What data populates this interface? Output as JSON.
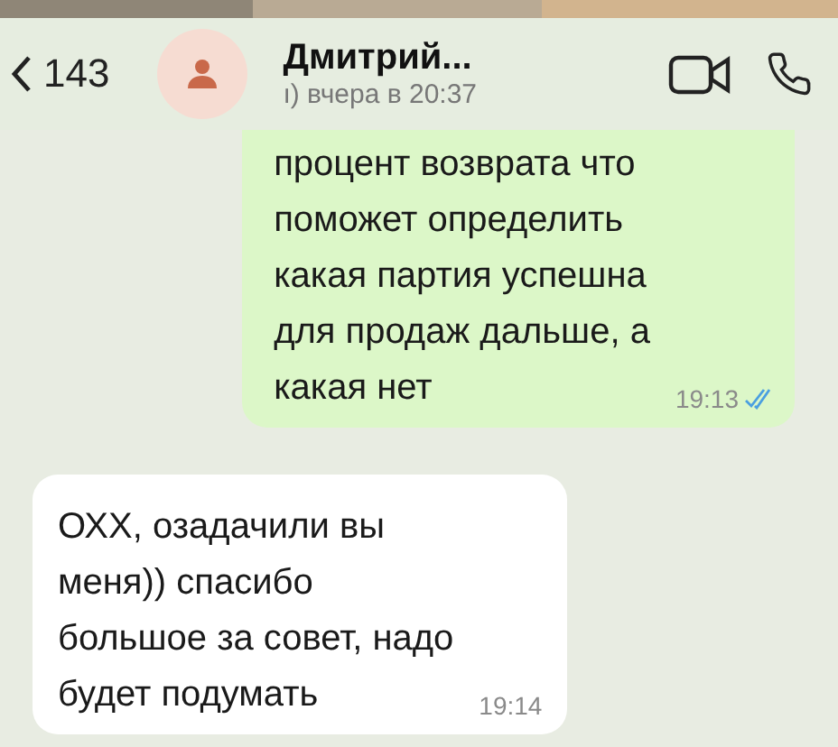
{
  "header": {
    "back_count": "143",
    "contact_name": "Дмитрий...",
    "status": "ı) вчера в 20:37"
  },
  "messages": [
    {
      "kind": "outgoing",
      "text": "процент возврата что\nпоможет определить\nкакая партия успешна\nдля продаж дальше, а\nкакая нет",
      "time": "19:13",
      "read": true
    },
    {
      "kind": "incoming",
      "text": "ОХХ, озадачили вы\nменя)) спасибо\nбольшое за совет, надо\nбудет подумать",
      "time": "19:14"
    }
  ]
}
